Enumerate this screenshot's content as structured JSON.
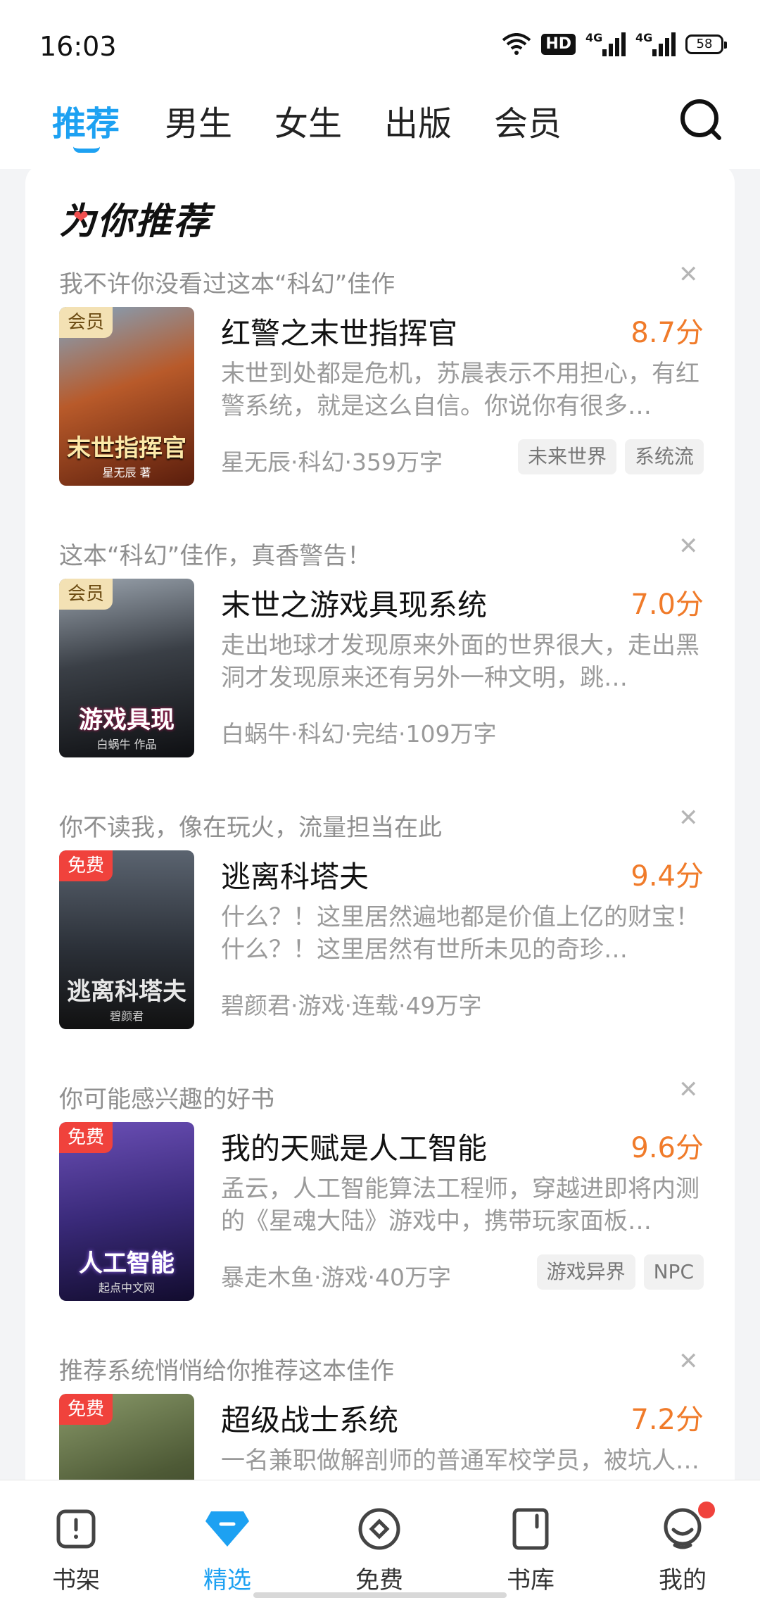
{
  "status": {
    "time": "16:03",
    "hd": "HD",
    "net1": "4G",
    "net2": "4G",
    "battery": "58"
  },
  "top_tabs": [
    "推荐",
    "男生",
    "女生",
    "出版",
    "会员"
  ],
  "section_title": "为你推荐",
  "recommendations": [
    {
      "reason": "我不许你没看过这本“科幻”佳作",
      "badge": "会员",
      "cover_title": "末世指挥官",
      "cover_author": "星无辰 著",
      "title": "红警之末世指挥官",
      "score": "8.7分",
      "desc": "末世到处都是危机，苏晨表示不用担心，有红警系统，就是这么自信。你说你有很多…",
      "meta": "星无辰·科幻·359万字",
      "tags": [
        "未来世界",
        "系统流"
      ]
    },
    {
      "reason": "这本“科幻”佳作，真香警告！",
      "badge": "会员",
      "cover_title": "游戏具现",
      "cover_author": "白蜗牛 作品",
      "title": "末世之游戏具现系统",
      "score": "7.0分",
      "desc": "走出地球才发现原来外面的世界很大，走出黑洞才发现原来还有另外一种文明，跳…",
      "meta": "白蜗牛·科幻·完结·109万字",
      "tags": []
    },
    {
      "reason": "你不读我，像在玩火，流量担当在此",
      "badge": "免费",
      "cover_title": "逃离科塔夫",
      "cover_author": "碧颜君",
      "title": "逃离科塔夫",
      "score": "9.4分",
      "desc": "什么？！这里居然遍地都是价值上亿的财宝！什么？！这里居然有世所未见的奇珍…",
      "meta": "碧颜君·游戏·连载·49万字",
      "tags": []
    },
    {
      "reason": "你可能感兴趣的好书",
      "badge": "免费",
      "cover_title": "人工智能",
      "cover_author": "起点中文网",
      "title": "我的天赋是人工智能",
      "score": "9.6分",
      "desc": "孟云，人工智能算法工程师，穿越进即将内测的《星魂大陆》游戏中，携带玩家面板…",
      "meta": "暴走木鱼·游戏·40万字",
      "tags": [
        "游戏异界",
        "NPC"
      ]
    },
    {
      "reason": "推荐系统悄悄给你推荐这本佳作",
      "badge": "免费",
      "cover_title": "",
      "cover_author": "",
      "title": "超级战士系统",
      "score": "7.2分",
      "desc": "一名兼职做解剖师的普通军校学员，被坑人…",
      "meta": "",
      "tags": []
    }
  ],
  "bottom_nav": [
    "书架",
    "精选",
    "免费",
    "书库",
    "我的"
  ],
  "colors": {
    "accent": "#1da1f2",
    "score": "#f07b2a",
    "free_badge": "#f0423c",
    "vip_badge": "#f3e1b4"
  }
}
